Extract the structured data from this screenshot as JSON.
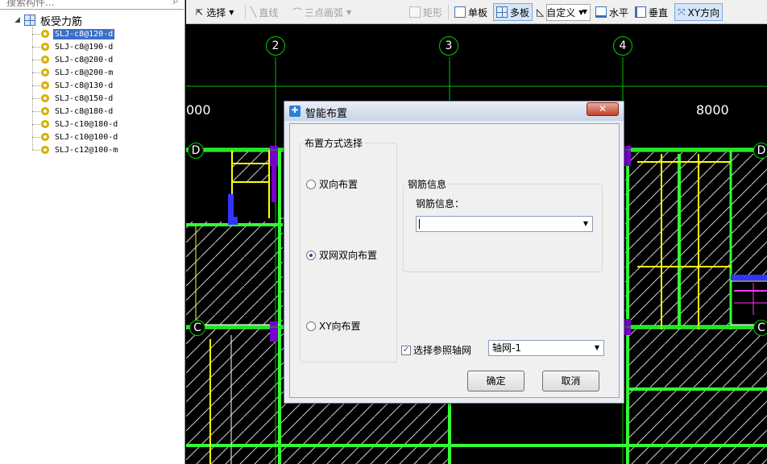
{
  "left_panel": {
    "search_placeholder": "搜索构件...",
    "tree_root": "板受力筋",
    "items": [
      {
        "label": "SLJ-c8@120-d",
        "selected": true
      },
      {
        "label": "SLJ-c8@190-d"
      },
      {
        "label": "SLJ-c8@200-d"
      },
      {
        "label": "SLJ-c8@200-m"
      },
      {
        "label": "SLJ-c8@130-d"
      },
      {
        "label": "SLJ-c8@150-d"
      },
      {
        "label": "SLJ-c8@180-d"
      },
      {
        "label": "SLJ-c10@180-d"
      },
      {
        "label": "SLJ-c10@100-d"
      },
      {
        "label": "SLJ-c12@100-m"
      }
    ]
  },
  "toolbar": {
    "select": "选择",
    "line": "直线",
    "arc": "三点画弧",
    "rect": "矩形",
    "single": "单板",
    "multi": "多板",
    "custom": "自定义",
    "horizontal": "水平",
    "vertical": "垂直",
    "xy": "XY方向"
  },
  "canvas": {
    "axis_numbers": [
      "2",
      "3",
      "4"
    ],
    "row_labels": [
      "D",
      "C"
    ],
    "dim_left": "000",
    "dim_right": "8000",
    "colors": {
      "grid": "#00d000",
      "beam": "#33ff33",
      "wall": "#ffff00",
      "column": "#7a00cc"
    }
  },
  "dialog": {
    "title": "智能布置",
    "close": "✕",
    "group_layout": "布置方式选择",
    "radio1": "双向布置",
    "radio2": "双网双向布置",
    "radio3": "XY向布置",
    "selected_radio": 2,
    "group_rebar": "钢筋信息",
    "rebar_label": "钢筋信息：",
    "rebar_value": "",
    "checkbox_label": "选择参照轴网",
    "checkbox_checked": true,
    "grid_select": "轴网-1",
    "ok": "确定",
    "cancel": "取消"
  }
}
